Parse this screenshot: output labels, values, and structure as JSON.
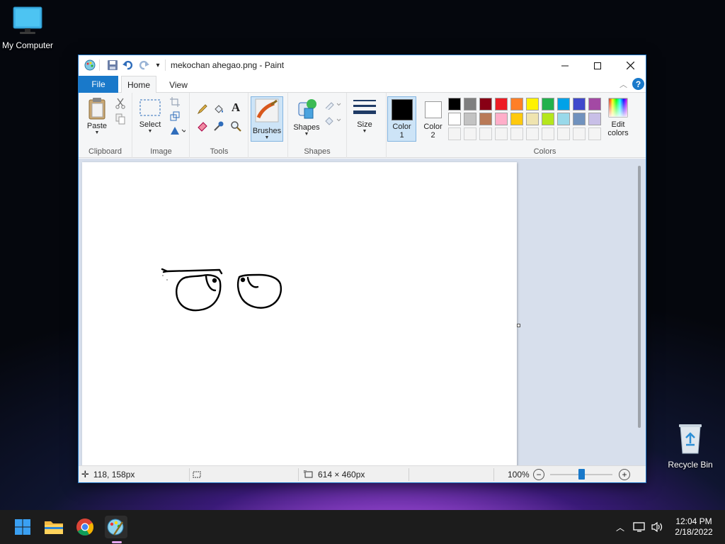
{
  "desktop": {
    "my_computer_label": "My Computer",
    "recycle_bin_label": "Recycle Bin"
  },
  "window": {
    "title": "mekochan ahegao.png - Paint"
  },
  "tabs": {
    "file": "File",
    "home": "Home",
    "view": "View"
  },
  "ribbon": {
    "clipboard": {
      "paste_label": "Paste",
      "group_label": "Clipboard"
    },
    "image": {
      "select_label": "Select",
      "group_label": "Image"
    },
    "tools": {
      "group_label": "Tools"
    },
    "brushes": {
      "label": "Brushes"
    },
    "shapes": {
      "label": "Shapes",
      "group_label": "Shapes"
    },
    "size": {
      "label": "Size"
    },
    "color1": {
      "label_line1": "Color",
      "label_line2": "1",
      "value": "#000000"
    },
    "color2": {
      "label_line1": "Color",
      "label_line2": "2",
      "value": "#ffffff"
    },
    "colors": {
      "group_label": "Colors",
      "edit_label_line1": "Edit",
      "edit_label_line2": "colors",
      "row1": [
        "#000000",
        "#7f7f7f",
        "#880015",
        "#ed1c24",
        "#ff7f27",
        "#fff200",
        "#22b14c",
        "#00a2e8",
        "#3f48cc",
        "#a349a4"
      ],
      "row2": [
        "#ffffff",
        "#c3c3c3",
        "#b97a57",
        "#ffaec9",
        "#ffc90e",
        "#efe4b0",
        "#b5e61d",
        "#99d9ea",
        "#7092be",
        "#c8bfe7"
      ]
    }
  },
  "status": {
    "cursor_pos": "118, 158px",
    "image_size": "614 × 460px",
    "zoom": "100%",
    "zoom_slider_fraction": 0.5
  },
  "taskbar": {
    "time": "12:04 PM",
    "date": "2/18/2022"
  }
}
